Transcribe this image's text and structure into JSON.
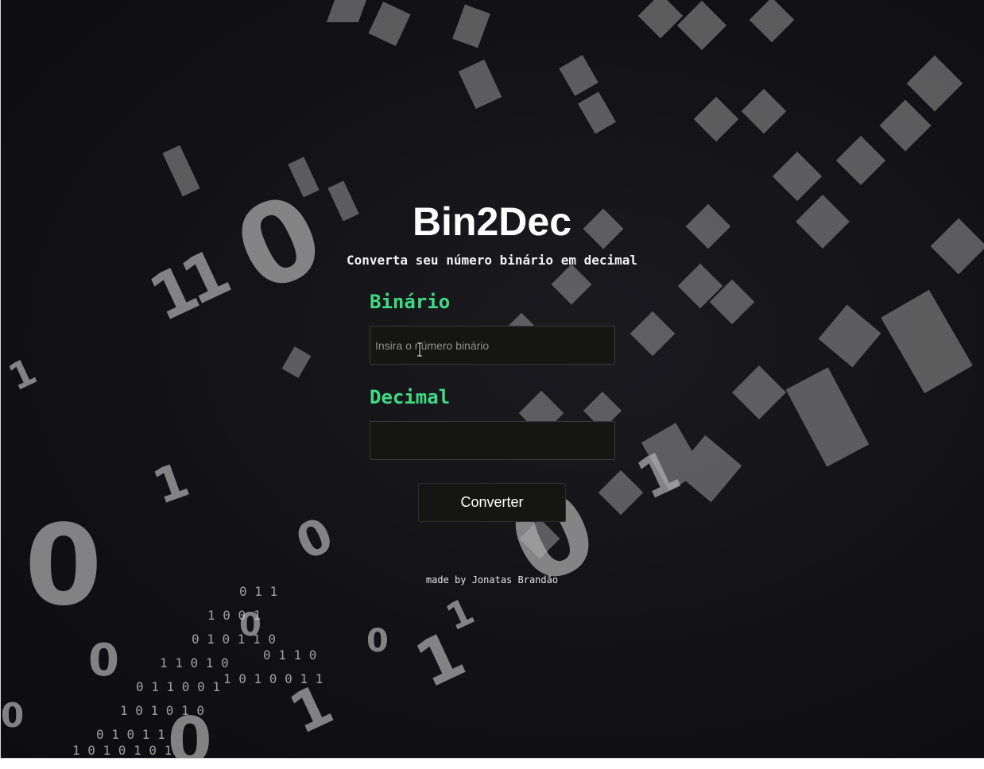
{
  "app": {
    "title": "Bin2Dec",
    "subtitle": "Converta seu número binário em decimal"
  },
  "form": {
    "binary_label": "Binário",
    "binary_placeholder": "Insira o número binário",
    "binary_value": "",
    "decimal_label": "Decimal",
    "decimal_value": "",
    "convert_label": "Converter"
  },
  "footer": {
    "credit": "made by Jonatas Brandão"
  },
  "colors": {
    "background": "#121216",
    "accent_green": "#3ddc84",
    "field_bg": "#151513",
    "text": "#ffffff"
  },
  "icons": {
    "cursor": "text-cursor-icon"
  }
}
